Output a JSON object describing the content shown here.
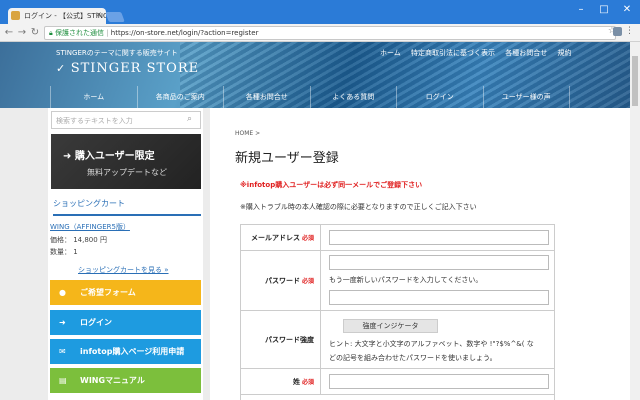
{
  "browser": {
    "tab_title": "ログイン - 【公式】STINGER",
    "secure_label": "保護された通信",
    "url": "https://on-store.net/login/?action=register"
  },
  "site": {
    "tagline": "STINGERのテーマに関する販売サイト",
    "logo": "STINGER STORE",
    "top_nav": [
      "ホーム",
      "特定商取引法に基づく表示",
      "各種お問合せ",
      "規約"
    ],
    "main_nav": [
      "ホーム",
      "各商品のご案内",
      "各種お問合せ",
      "よくある質問",
      "ログイン",
      "ユーザー様の声"
    ]
  },
  "sidebar": {
    "search_placeholder": "検索するテキストを入力",
    "banner_title": "購入ユーザー限定",
    "banner_sub": "無料アップデートなど",
    "cart_heading": "ショッピングカート",
    "cart_item": "WING（AFFINGER5版）",
    "cart_price": "価格： 14,800 円",
    "cart_qty": "数量： 1",
    "cart_link": "ショッピングカートを見る »",
    "buttons": [
      {
        "label": "ご希望フォーム",
        "icon": "mic-icon",
        "color": "#f5b61a"
      },
      {
        "label": "ログイン",
        "icon": "signin-icon",
        "color": "#1e9be0"
      },
      {
        "label": "infotop購入ページ利用申請",
        "icon": "mail-icon",
        "color": "#1e9be0"
      },
      {
        "label": "WINGマニュアル",
        "icon": "book-icon",
        "color": "#7cbf3c"
      }
    ]
  },
  "main": {
    "breadcrumb": "HOME >",
    "title": "新規ユーザー登録",
    "warning": "※infotop購入ユーザーは必ず同一メールでご登録下さい",
    "note": "※購入トラブル時の本人確認の際に必要となりますので正しくご記入下さい",
    "required": "必須",
    "email_label": "メールアドレス",
    "password_label": "パスワード",
    "password_hint": "もう一度新しいパスワードを入力してください。",
    "strength_label": "パスワード強度",
    "strength_button": "強度インジケータ",
    "strength_hint_1": "ヒント: 大文字と小文字のアルファベット、数字や !\"?$%^&( な",
    "strength_hint_2": "どの記号を組み合わせたパスワードを使いましょう。",
    "surname_label": "姓"
  }
}
